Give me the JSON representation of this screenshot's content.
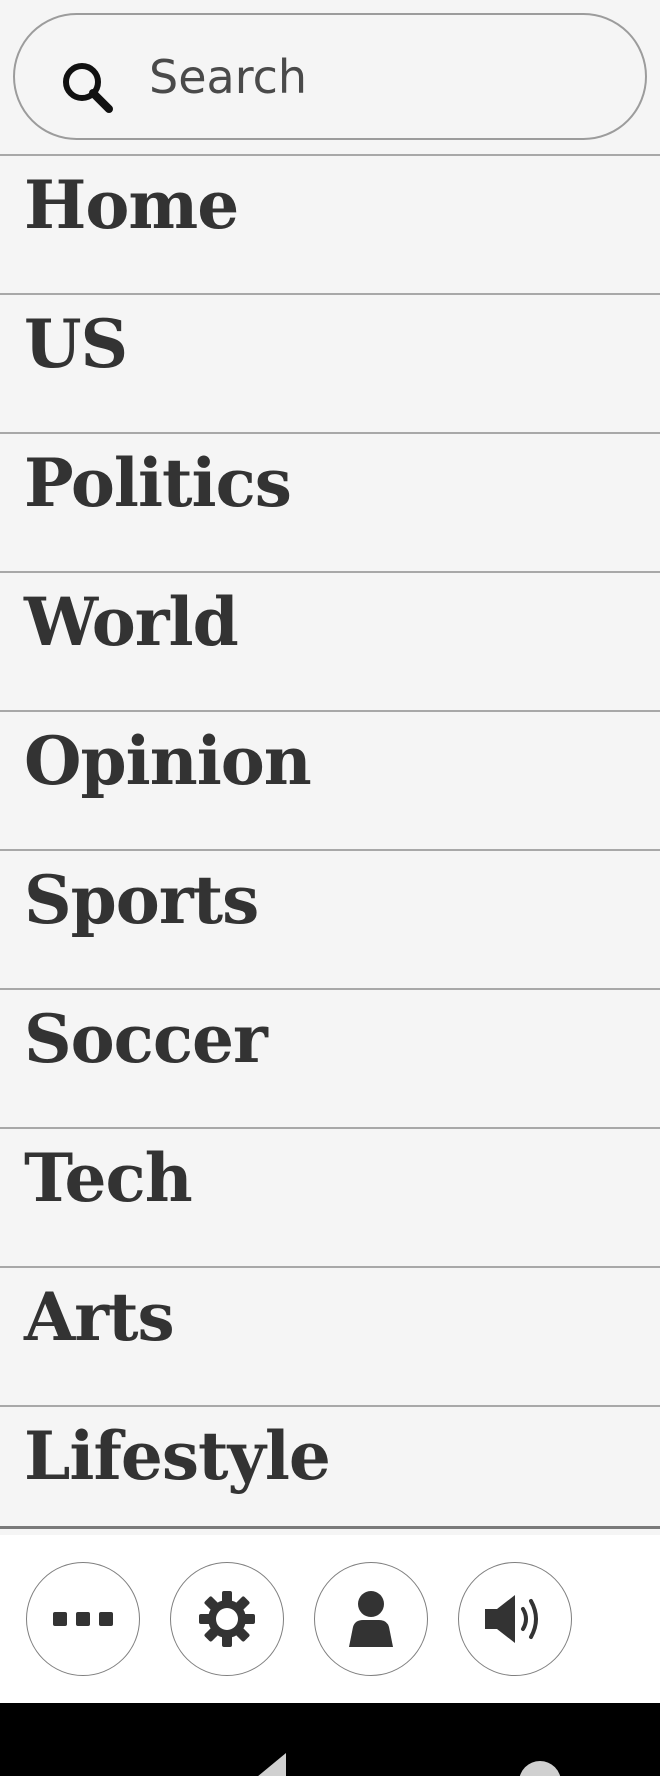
{
  "search": {
    "placeholder": "Search",
    "icon": "search-icon"
  },
  "nav": {
    "items": [
      {
        "label": "Home"
      },
      {
        "label": "US"
      },
      {
        "label": "Politics"
      },
      {
        "label": "World"
      },
      {
        "label": "Opinion"
      },
      {
        "label": "Sports"
      },
      {
        "label": "Soccer"
      },
      {
        "label": "Tech"
      },
      {
        "label": "Arts"
      },
      {
        "label": "Lifestyle"
      }
    ]
  },
  "toolbar": {
    "buttons": [
      {
        "icon": "more-icon"
      },
      {
        "icon": "gear-icon"
      },
      {
        "icon": "person-icon"
      },
      {
        "icon": "speaker-icon"
      }
    ]
  },
  "system_bar": {
    "buttons": [
      "back-icon",
      "home-icon"
    ]
  },
  "colors": {
    "background": "#f5f5f5",
    "text": "#333333",
    "divider": "#a8a8a8",
    "system_bar": "#000000"
  }
}
